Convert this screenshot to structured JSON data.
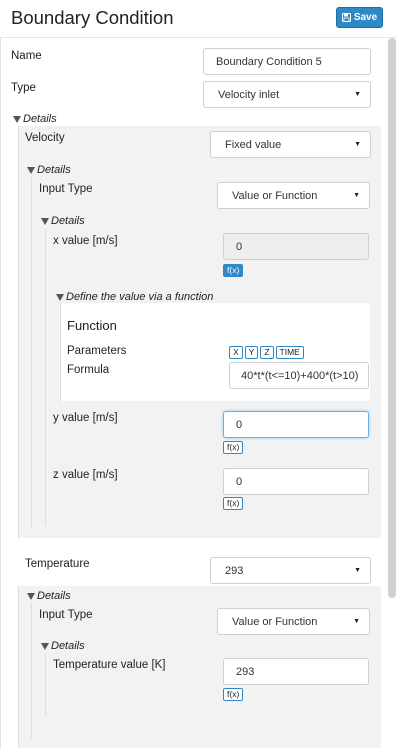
{
  "header": {
    "title": "Boundary Condition",
    "save_label": "Save"
  },
  "form": {
    "name_label": "Name",
    "name_value": "Boundary Condition 5",
    "type_label": "Type",
    "type_value": "Velocity inlet",
    "details_label": "Details",
    "velocity": {
      "label": "Velocity",
      "value": "Fixed value",
      "details_label": "Details",
      "input_type_label": "Input Type",
      "input_type_value": "Value or Function",
      "inner_details_label": "Details",
      "x": {
        "label": "x value [m/s]",
        "value": "0",
        "fx": "f(x)"
      },
      "function_section": {
        "toggle_label": "Define the value via a function",
        "heading": "Function",
        "parameters_label": "Parameters",
        "parameters": [
          "X",
          "Y",
          "Z",
          "TIME"
        ],
        "formula_label": "Formula",
        "formula_value": "40*t*(t<=10)+400*(t>10)"
      },
      "y": {
        "label": "y value [m/s]",
        "value": "0",
        "fx": "f(x)"
      },
      "z": {
        "label": "z value [m/s]",
        "value": "0",
        "fx": "f(x)"
      }
    },
    "temperature": {
      "label": "Temperature",
      "value": "293",
      "details_label": "Details",
      "input_type_label": "Input Type",
      "input_type_value": "Value or Function",
      "inner_details_label": "Details",
      "value_label": "Temperature value [K]",
      "fx": "f(x)"
    }
  },
  "icons": {
    "save": "floppy-disk-icon",
    "expand": "triangle-down-icon",
    "dropdown": "caret-down-icon"
  },
  "colors": {
    "accent": "#2d8ac7",
    "panel": "#f2f2f2"
  }
}
